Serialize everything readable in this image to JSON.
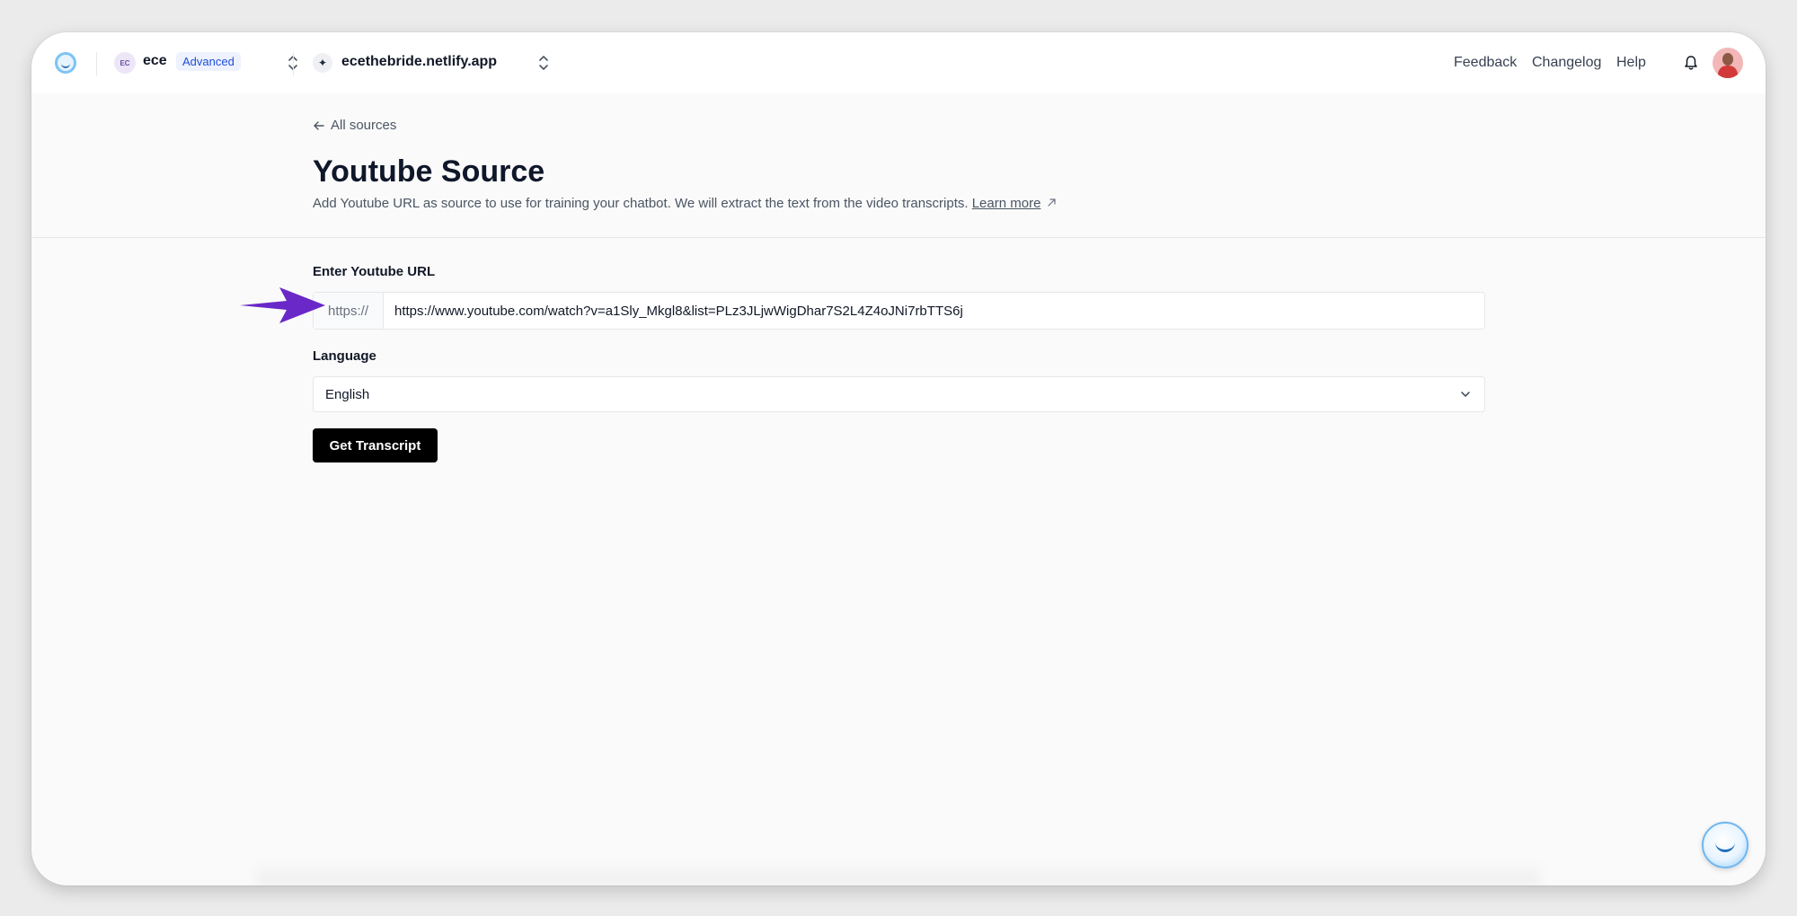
{
  "topbar": {
    "workspace_initials": "EC",
    "workspace_name": "ece",
    "plan_badge": "Advanced",
    "site_name": "ecethebride.netlify.app",
    "links": {
      "feedback": "Feedback",
      "changelog": "Changelog",
      "help": "Help"
    }
  },
  "header": {
    "back_label": "All sources",
    "title": "Youtube Source",
    "subtitle": "Add Youtube URL as source to use for training your chatbot. We will extract the text from the video transcripts.",
    "learn_more": "Learn more"
  },
  "form": {
    "url_label": "Enter Youtube URL",
    "url_prefix": "https://",
    "url_value": "https://www.youtube.com/watch?v=a1Sly_Mkgl8&list=PLz3JLjwWigDhar7S2L4Z4oJNi7rbTTS6j",
    "language_label": "Language",
    "language_selected": "English",
    "submit_label": "Get Transcript"
  },
  "icons": {
    "logo": "smile-logo-icon",
    "workspace_switcher": "chevron-up-down-icon",
    "site": "sparkle-icon",
    "back": "arrow-left-icon",
    "external": "arrow-up-right-icon",
    "bell": "bell-icon",
    "select": "chevron-down-icon",
    "chat": "chat-widget-icon",
    "annotation": "purple-arrow-icon"
  },
  "colors": {
    "annotation_arrow": "#6a28c8",
    "primary_button": "#000000",
    "badge_bg": "#eef2ff",
    "badge_text": "#1d4ed8"
  }
}
